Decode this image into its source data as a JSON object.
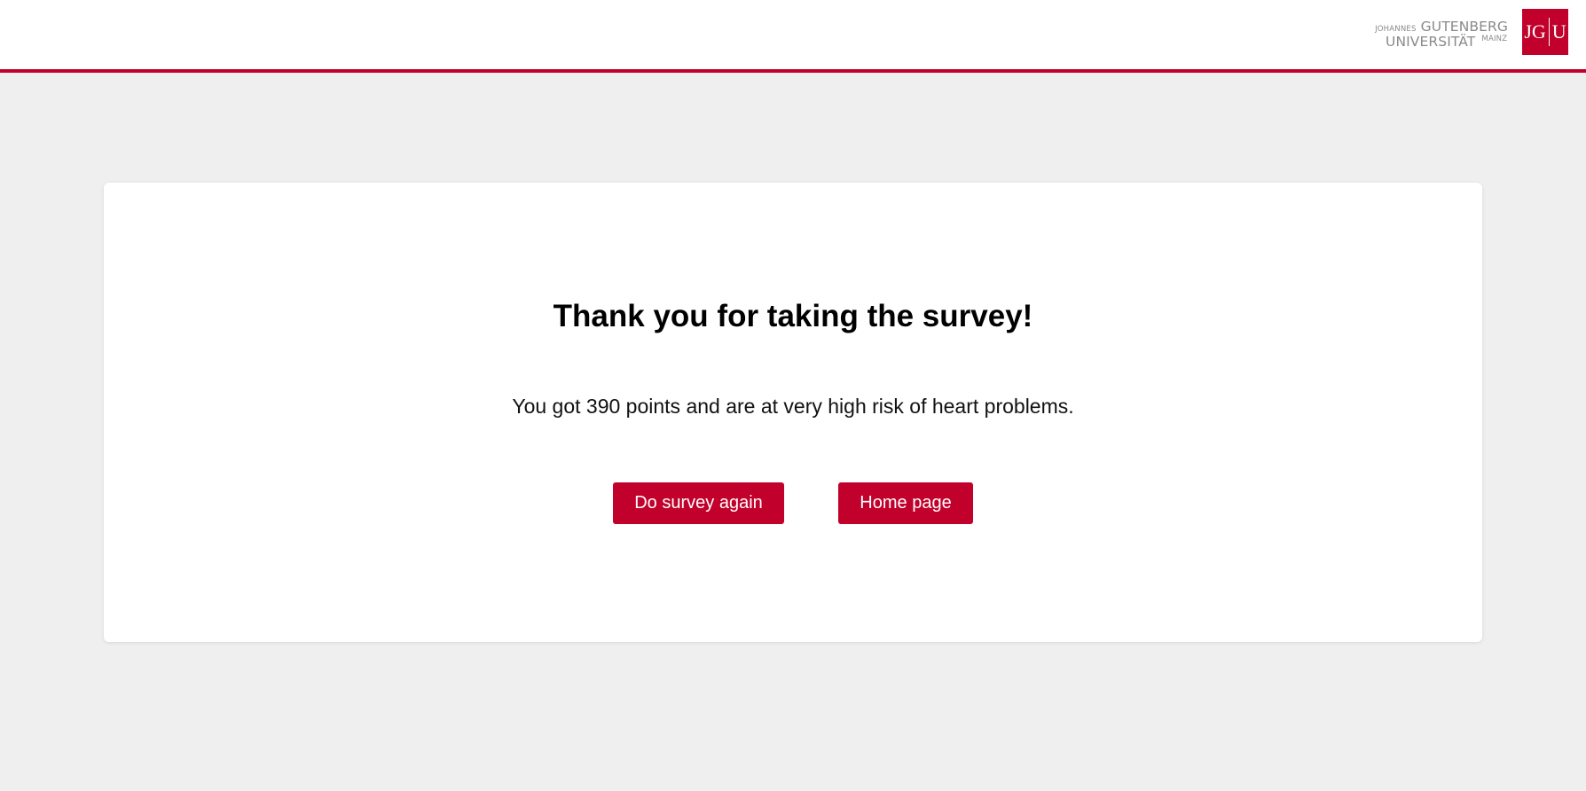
{
  "header": {
    "brand": {
      "prefix": "JOHANNES",
      "name_line1": "GUTENBERG",
      "name_line2": "UNIVERSITÄT",
      "suffix": "MAINZ",
      "logo_left": "JG",
      "logo_right": "U"
    },
    "accent_color": "#c1002b"
  },
  "main": {
    "title": "Thank you for taking the survey!",
    "message": "You got 390 points and are at very high risk of heart problems.",
    "buttons": {
      "again_label": "Do survey again",
      "home_label": "Home page"
    }
  }
}
